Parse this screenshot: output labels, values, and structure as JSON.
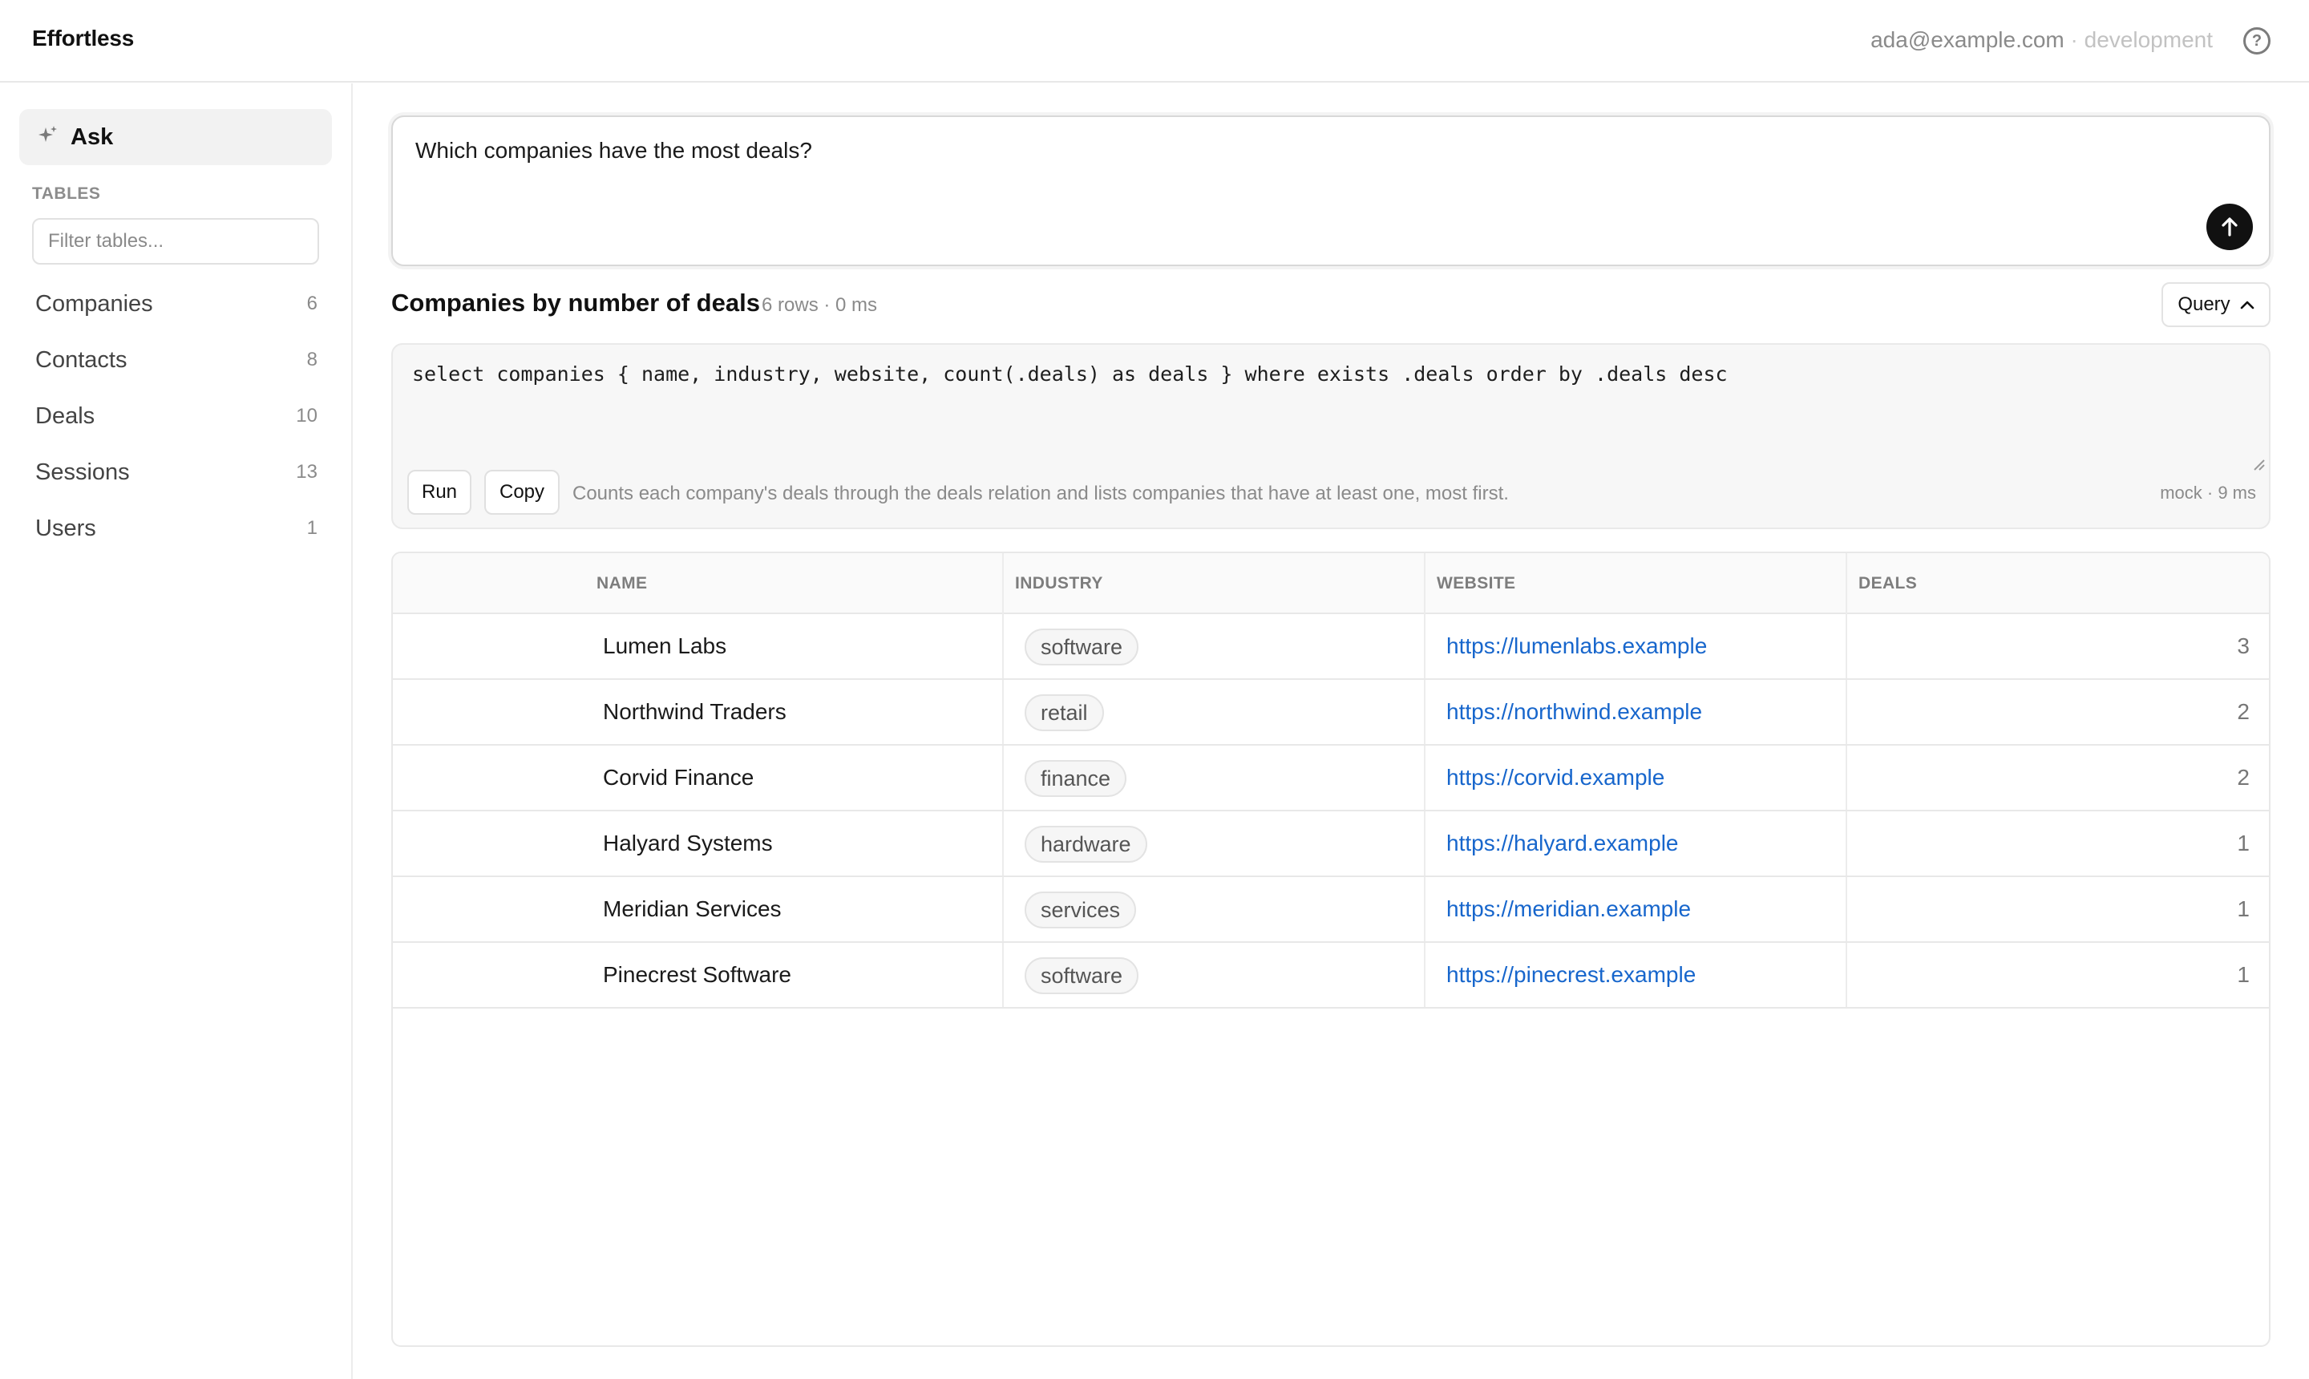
{
  "app": {
    "title": "Effortless"
  },
  "account": {
    "email": "ada@example.com",
    "separator": "·",
    "environment": "development"
  },
  "icons": {
    "help": "help-circle-icon",
    "ask": "sparkle-icon",
    "send": "arrow-up-icon",
    "toggle": "chevron-up-icon"
  },
  "sidebar": {
    "ask_label": "Ask",
    "tables_heading": "TABLES",
    "filter_placeholder": "Filter tables...",
    "tables": [
      {
        "name": "Companies",
        "count": "6"
      },
      {
        "name": "Contacts",
        "count": "8"
      },
      {
        "name": "Deals",
        "count": "10"
      },
      {
        "name": "Sessions",
        "count": "13"
      },
      {
        "name": "Users",
        "count": "1"
      }
    ]
  },
  "ask": {
    "question": "Which companies have the most deals?"
  },
  "result": {
    "title": "Companies by number of deals",
    "meta": "6 rows · 0 ms",
    "query_toggle_label": "Query"
  },
  "query": {
    "code": "select companies { name, industry, website, count(.deals) as deals } where exists .deals order by .deals desc",
    "run_label": "Run",
    "copy_label": "Copy",
    "explanation": "Counts each company's deals through the deals relation and lists companies that have at least one, most first.",
    "timing": "mock · 9 ms"
  },
  "table": {
    "columns": [
      "NAME",
      "INDUSTRY",
      "WEBSITE",
      "DEALS"
    ],
    "rows": [
      {
        "name": "Lumen Labs",
        "industry": "software",
        "website": "https://lumenlabs.example",
        "deals": "3"
      },
      {
        "name": "Northwind Traders",
        "industry": "retail",
        "website": "https://northwind.example",
        "deals": "2"
      },
      {
        "name": "Corvid Finance",
        "industry": "finance",
        "website": "https://corvid.example",
        "deals": "2"
      },
      {
        "name": "Halyard Systems",
        "industry": "hardware",
        "website": "https://halyard.example",
        "deals": "1"
      },
      {
        "name": "Meridian Services",
        "industry": "services",
        "website": "https://meridian.example",
        "deals": "1"
      },
      {
        "name": "Pinecrest Software",
        "industry": "software",
        "website": "https://pinecrest.example",
        "deals": "1"
      }
    ]
  },
  "colors": {
    "accent": "#111111",
    "link": "#1766cc",
    "muted": "#8a8a8a"
  }
}
